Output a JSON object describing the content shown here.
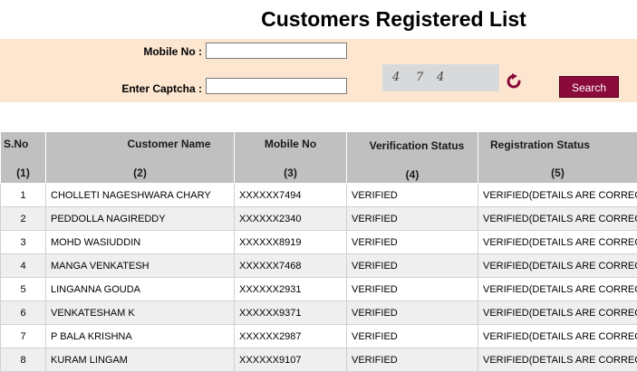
{
  "page": {
    "title": "Customers Registered List"
  },
  "search": {
    "mobile_label": "Mobile No :",
    "mobile_value": "",
    "captcha_label": "Enter Captcha :",
    "captcha_value": "",
    "captcha_digits": [
      "4",
      "7",
      "4"
    ],
    "refresh_icon": "refresh-icon",
    "button_label": "Search"
  },
  "table": {
    "headers": [
      {
        "label": "S.No",
        "num": "(1)"
      },
      {
        "label": "Customer Name",
        "num": "(2)"
      },
      {
        "label": "Mobile No",
        "num": "(3)"
      },
      {
        "label": "Verification Status",
        "num": "(4)"
      },
      {
        "label": "Registration Status",
        "num": "(5)"
      }
    ],
    "rows": [
      [
        "1",
        "CHOLLETI NAGESHWARA CHARY",
        "XXXXXX7494",
        "VERIFIED",
        "VERIFIED(DETAILS ARE CORRECT)"
      ],
      [
        "2",
        "PEDDOLLA NAGIREDDY",
        "XXXXXX2340",
        "VERIFIED",
        "VERIFIED(DETAILS ARE CORRECT)"
      ],
      [
        "3",
        "MOHD WASIUDDIN",
        "XXXXXX8919",
        "VERIFIED",
        "VERIFIED(DETAILS ARE CORRECT)"
      ],
      [
        "4",
        "MANGA VENKATESH",
        "XXXXXX7468",
        "VERIFIED",
        "VERIFIED(DETAILS ARE CORRECT)"
      ],
      [
        "5",
        "LINGANNA GOUDA",
        "XXXXXX2931",
        "VERIFIED",
        "VERIFIED(DETAILS ARE CORRECT)"
      ],
      [
        "6",
        "VENKATESHAM K",
        "XXXXXX9371",
        "VERIFIED",
        "VERIFIED(DETAILS ARE CORRECT)"
      ],
      [
        "7",
        "P BALA KRISHNA",
        "XXXXXX2987",
        "VERIFIED",
        "VERIFIED(DETAILS ARE CORRECT)"
      ],
      [
        "8",
        "KURAM LINGAM",
        "XXXXXX9107",
        "VERIFIED",
        "VERIFIED(DETAILS ARE CORRECT)"
      ]
    ]
  },
  "colors": {
    "panel_bg": "#fce6d0",
    "button_bg": "#8a0a3a",
    "header_bg": "#c0c0c0",
    "refresh_icon": "#8a0a3a"
  }
}
